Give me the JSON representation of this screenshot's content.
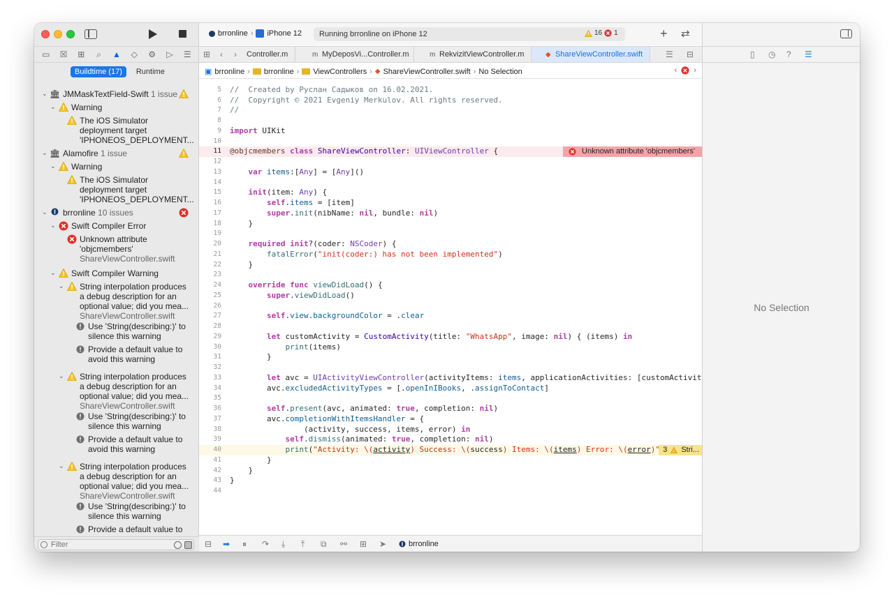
{
  "toolbar": {
    "scheme": "brronline",
    "device": "iPhone 12",
    "status": "Running brronline on iPhone 12",
    "warning_count": "16",
    "error_count": "1"
  },
  "navigator": {
    "segments": [
      "Buildtime (17)",
      "Runtime"
    ],
    "filter_placeholder": "Filter",
    "groups": [
      {
        "name": "JMMaskTextField-Swift",
        "count": "1 issue"
      },
      {
        "name": "Alamofire",
        "count": "1 issue"
      },
      {
        "name": "brronline",
        "count": "10 issues"
      }
    ],
    "warning_label": "Warning",
    "sim_warning": [
      "The iOS Simulator",
      "deployment target",
      "'IPHONEOS_DEPLOYMENT..."
    ],
    "compiler_error": "Swift Compiler Error",
    "error_text": [
      "Unknown attribute",
      "'objcmembers'"
    ],
    "file": "ShareViewController.swift",
    "compiler_warning": "Swift Compiler Warning",
    "interp_warning": [
      "String interpolation produces",
      "a debug description for an",
      "optional value; did you mea..."
    ],
    "fix1": [
      "Use 'String(describing:)' to",
      "silence this warning"
    ],
    "fix2": [
      "Provide a default value to",
      "avoid this warning"
    ],
    "fix2_partial": "Provide a default value to"
  },
  "tabs": [
    {
      "label": "Controller.m",
      "icon": "m"
    },
    {
      "label": "MyDeposVi...Controller.m",
      "icon": "m"
    },
    {
      "label": "RekvizitViewController.m",
      "icon": "m"
    },
    {
      "label": "ShareViewController.swift",
      "icon": "swift"
    }
  ],
  "jumpbar": {
    "project": "brronline",
    "folder1": "brronline",
    "folder2": "ViewControllers",
    "file": "ShareViewController.swift",
    "selection": "No Selection"
  },
  "code": {
    "error_message": "Unknown attribute 'objcmembers'",
    "warning_count": "3",
    "warning_message": "Stri..."
  },
  "debug": {
    "target": "brronline"
  },
  "inspector": {
    "empty_text": "No Selection"
  }
}
